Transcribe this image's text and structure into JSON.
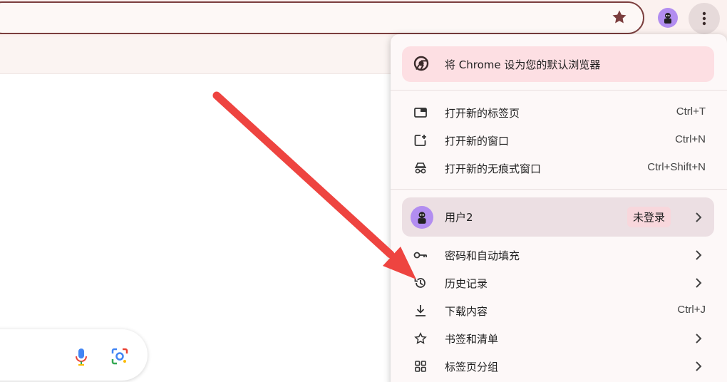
{
  "colors": {
    "accent": "#7b3e3e",
    "arrow": "#ee4440",
    "promo_bg": "#fddfe3",
    "profile_bg": "#ecdfe3",
    "avatar": "#b28df0"
  },
  "toolbar": {
    "star_icon": "star-icon",
    "profile_icon": "profile-avatar-icon",
    "menu_icon": "kebab-menu-icon"
  },
  "menu": {
    "promo": {
      "label": "将 Chrome 设为您的默认浏览器",
      "icon": "chrome-icon"
    },
    "new_items": [
      {
        "label": "打开新的标签页",
        "shortcut": "Ctrl+T",
        "icon": "new-tab-icon"
      },
      {
        "label": "打开新的窗口",
        "shortcut": "Ctrl+N",
        "icon": "new-window-icon"
      },
      {
        "label": "打开新的无痕式窗口",
        "shortcut": "Ctrl+Shift+N",
        "icon": "incognito-icon"
      }
    ],
    "profile": {
      "name": "用户2",
      "status": "未登录"
    },
    "items": [
      {
        "label": "密码和自动填充",
        "shortcut": "",
        "icon": "key-icon"
      },
      {
        "label": "历史记录",
        "shortcut": "",
        "icon": "history-icon"
      },
      {
        "label": "下载内容",
        "shortcut": "Ctrl+J",
        "icon": "download-icon"
      },
      {
        "label": "书签和清单",
        "shortcut": "",
        "icon": "star-outline-icon"
      },
      {
        "label": "标签页分组",
        "shortcut": "",
        "icon": "grid-icon"
      }
    ]
  },
  "search": {
    "mic_icon": "mic-icon",
    "lens_icon": "lens-icon"
  }
}
